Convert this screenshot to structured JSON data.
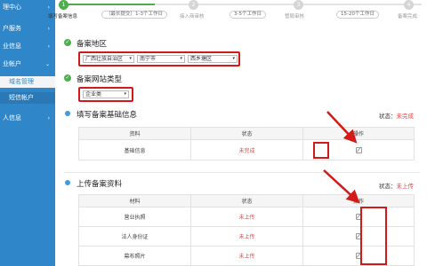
{
  "sidebar": {
    "items": [
      {
        "label": "理中心",
        "chevron": "›"
      },
      {
        "label": "户服务",
        "chevron": "›"
      },
      {
        "label": "业信息",
        "chevron": "›"
      },
      {
        "label": "业帐户",
        "chevron": "⌄"
      },
      {
        "label": "域名管理",
        "chevron": ""
      },
      {
        "label": "短信帐户",
        "chevron": ""
      },
      {
        "label": "人信息",
        "chevron": "›"
      }
    ]
  },
  "stepper": {
    "steps": [
      {
        "number": "1",
        "label": "填写备案信息"
      },
      {
        "number": "2",
        "label": "接入商审核"
      },
      {
        "number": "3",
        "label": "管局审核"
      },
      {
        "number": "4",
        "label": "备案完成"
      }
    ],
    "durations": [
      "（最长提交）1-3个工作日",
      "3-5个工作日",
      "15-20个工作日"
    ]
  },
  "region": {
    "title": "备案地区",
    "province": "广西壮族自治区",
    "city": "南宁市",
    "district": "西乡塘区"
  },
  "site_type": {
    "title": "备案网站类型",
    "value": "企业类"
  },
  "basic_info": {
    "title": "填写备案基础信息",
    "status_label": "状态：",
    "status_value": "未完成",
    "headers": [
      "资料",
      "状态",
      "操作"
    ],
    "rows": [
      {
        "name": "基础信息",
        "status": "未完成"
      }
    ]
  },
  "upload": {
    "title": "上传备案资料",
    "status_label": "状态：",
    "status_value": "未上传",
    "headers": [
      "材料",
      "状态",
      "操作"
    ],
    "rows": [
      {
        "name": "营业执照",
        "status": "未上传"
      },
      {
        "name": "法人身份证",
        "status": "未上传"
      },
      {
        "name": "幕布照片",
        "status": "未上传"
      }
    ]
  },
  "icons": {
    "check": "check-circle-icon",
    "dot": "info-dot-icon",
    "edit": "edit-icon"
  },
  "colors": {
    "sidebar": "#2f86c8",
    "success": "#4cae4c",
    "accent_blue": "#3f9be0",
    "status_red": "#e84343",
    "annotation_red": "#d41919"
  }
}
